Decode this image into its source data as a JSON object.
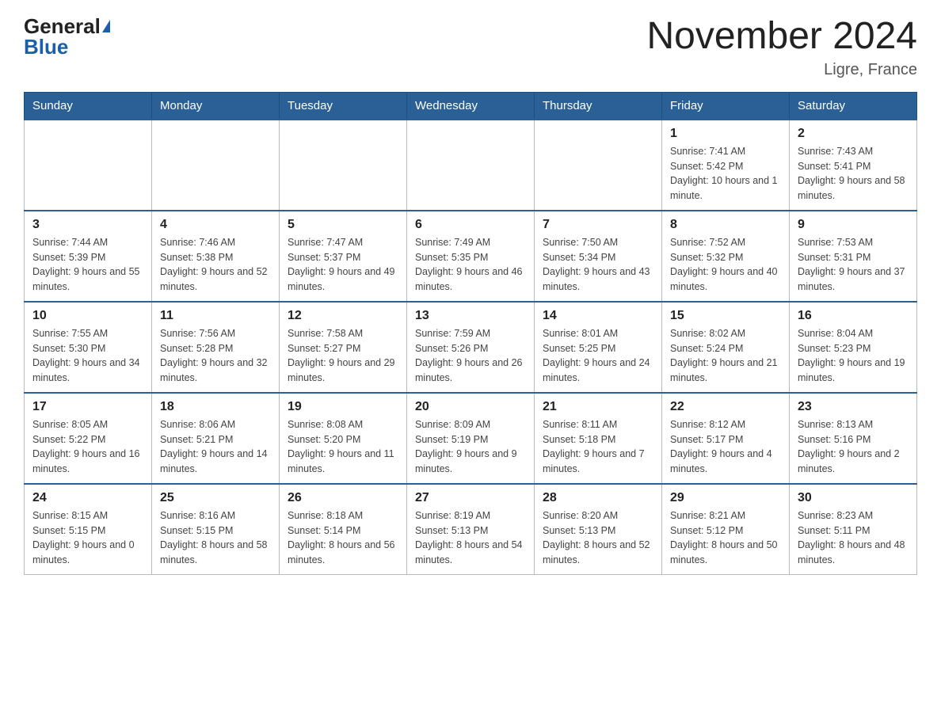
{
  "header": {
    "logo_general": "General",
    "logo_blue": "Blue",
    "title": "November 2024",
    "location": "Ligre, France"
  },
  "days_of_week": [
    "Sunday",
    "Monday",
    "Tuesday",
    "Wednesday",
    "Thursday",
    "Friday",
    "Saturday"
  ],
  "weeks": [
    [
      {
        "day": "",
        "info": ""
      },
      {
        "day": "",
        "info": ""
      },
      {
        "day": "",
        "info": ""
      },
      {
        "day": "",
        "info": ""
      },
      {
        "day": "",
        "info": ""
      },
      {
        "day": "1",
        "info": "Sunrise: 7:41 AM\nSunset: 5:42 PM\nDaylight: 10 hours and 1 minute."
      },
      {
        "day": "2",
        "info": "Sunrise: 7:43 AM\nSunset: 5:41 PM\nDaylight: 9 hours and 58 minutes."
      }
    ],
    [
      {
        "day": "3",
        "info": "Sunrise: 7:44 AM\nSunset: 5:39 PM\nDaylight: 9 hours and 55 minutes."
      },
      {
        "day": "4",
        "info": "Sunrise: 7:46 AM\nSunset: 5:38 PM\nDaylight: 9 hours and 52 minutes."
      },
      {
        "day": "5",
        "info": "Sunrise: 7:47 AM\nSunset: 5:37 PM\nDaylight: 9 hours and 49 minutes."
      },
      {
        "day": "6",
        "info": "Sunrise: 7:49 AM\nSunset: 5:35 PM\nDaylight: 9 hours and 46 minutes."
      },
      {
        "day": "7",
        "info": "Sunrise: 7:50 AM\nSunset: 5:34 PM\nDaylight: 9 hours and 43 minutes."
      },
      {
        "day": "8",
        "info": "Sunrise: 7:52 AM\nSunset: 5:32 PM\nDaylight: 9 hours and 40 minutes."
      },
      {
        "day": "9",
        "info": "Sunrise: 7:53 AM\nSunset: 5:31 PM\nDaylight: 9 hours and 37 minutes."
      }
    ],
    [
      {
        "day": "10",
        "info": "Sunrise: 7:55 AM\nSunset: 5:30 PM\nDaylight: 9 hours and 34 minutes."
      },
      {
        "day": "11",
        "info": "Sunrise: 7:56 AM\nSunset: 5:28 PM\nDaylight: 9 hours and 32 minutes."
      },
      {
        "day": "12",
        "info": "Sunrise: 7:58 AM\nSunset: 5:27 PM\nDaylight: 9 hours and 29 minutes."
      },
      {
        "day": "13",
        "info": "Sunrise: 7:59 AM\nSunset: 5:26 PM\nDaylight: 9 hours and 26 minutes."
      },
      {
        "day": "14",
        "info": "Sunrise: 8:01 AM\nSunset: 5:25 PM\nDaylight: 9 hours and 24 minutes."
      },
      {
        "day": "15",
        "info": "Sunrise: 8:02 AM\nSunset: 5:24 PM\nDaylight: 9 hours and 21 minutes."
      },
      {
        "day": "16",
        "info": "Sunrise: 8:04 AM\nSunset: 5:23 PM\nDaylight: 9 hours and 19 minutes."
      }
    ],
    [
      {
        "day": "17",
        "info": "Sunrise: 8:05 AM\nSunset: 5:22 PM\nDaylight: 9 hours and 16 minutes."
      },
      {
        "day": "18",
        "info": "Sunrise: 8:06 AM\nSunset: 5:21 PM\nDaylight: 9 hours and 14 minutes."
      },
      {
        "day": "19",
        "info": "Sunrise: 8:08 AM\nSunset: 5:20 PM\nDaylight: 9 hours and 11 minutes."
      },
      {
        "day": "20",
        "info": "Sunrise: 8:09 AM\nSunset: 5:19 PM\nDaylight: 9 hours and 9 minutes."
      },
      {
        "day": "21",
        "info": "Sunrise: 8:11 AM\nSunset: 5:18 PM\nDaylight: 9 hours and 7 minutes."
      },
      {
        "day": "22",
        "info": "Sunrise: 8:12 AM\nSunset: 5:17 PM\nDaylight: 9 hours and 4 minutes."
      },
      {
        "day": "23",
        "info": "Sunrise: 8:13 AM\nSunset: 5:16 PM\nDaylight: 9 hours and 2 minutes."
      }
    ],
    [
      {
        "day": "24",
        "info": "Sunrise: 8:15 AM\nSunset: 5:15 PM\nDaylight: 9 hours and 0 minutes."
      },
      {
        "day": "25",
        "info": "Sunrise: 8:16 AM\nSunset: 5:15 PM\nDaylight: 8 hours and 58 minutes."
      },
      {
        "day": "26",
        "info": "Sunrise: 8:18 AM\nSunset: 5:14 PM\nDaylight: 8 hours and 56 minutes."
      },
      {
        "day": "27",
        "info": "Sunrise: 8:19 AM\nSunset: 5:13 PM\nDaylight: 8 hours and 54 minutes."
      },
      {
        "day": "28",
        "info": "Sunrise: 8:20 AM\nSunset: 5:13 PM\nDaylight: 8 hours and 52 minutes."
      },
      {
        "day": "29",
        "info": "Sunrise: 8:21 AM\nSunset: 5:12 PM\nDaylight: 8 hours and 50 minutes."
      },
      {
        "day": "30",
        "info": "Sunrise: 8:23 AM\nSunset: 5:11 PM\nDaylight: 8 hours and 48 minutes."
      }
    ]
  ]
}
